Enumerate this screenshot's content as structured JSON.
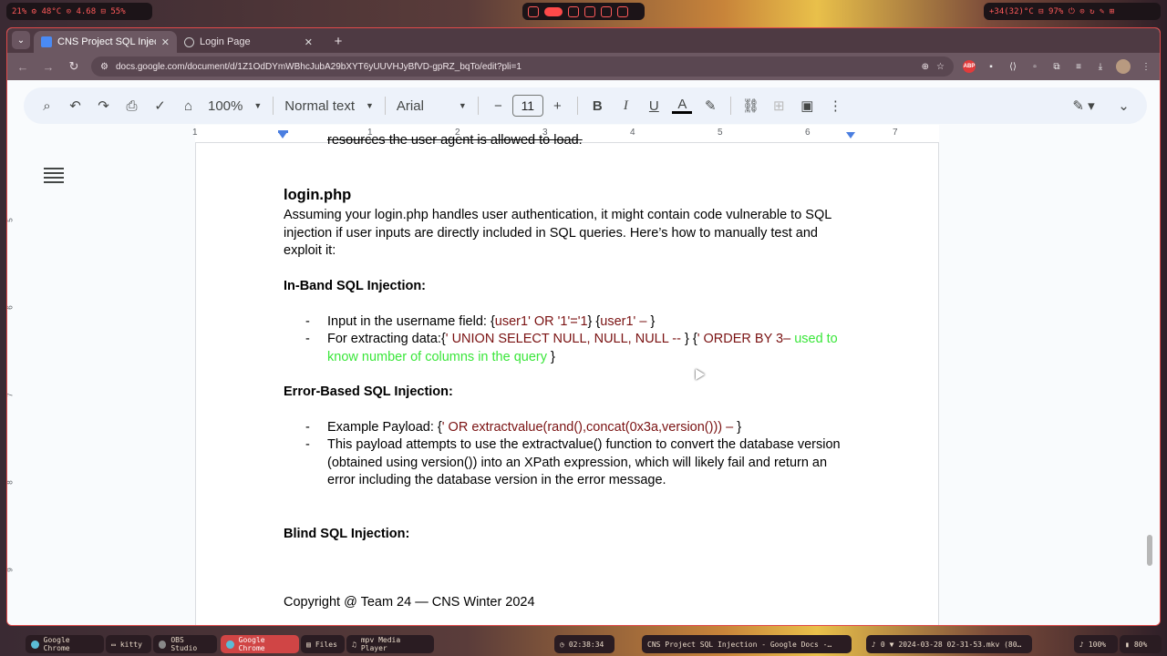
{
  "topbar": {
    "left_status": "21% ⚙ 48°C ⊙ 4.68 ⊟ 55%",
    "right_status": "+34(32)°C ⊟ 97% ⏻ ⊙ ↻ ✎ ⊞"
  },
  "browser": {
    "tabs": [
      {
        "label": "CNS Project SQL Injectio",
        "active": true
      },
      {
        "label": "Login Page",
        "active": false
      }
    ],
    "url": "docs.google.com/document/d/1Z1OdDYmWBhcJubA29bXYT6yUUVHJyBfVD-gpRZ_bqTo/edit?pli=1"
  },
  "toolbar": {
    "zoom": "100%",
    "style": "Normal text",
    "font": "Arial",
    "font_size": "11",
    "bold": "B",
    "italic": "I",
    "underline": "U",
    "text_color": "A"
  },
  "ruler": {
    "numbers": [
      "1",
      "1",
      "2",
      "3",
      "4",
      "5",
      "6",
      "7"
    ]
  },
  "document": {
    "prev_line": "resources the user agent is allowed to load.",
    "heading": "login.php",
    "intro": "Assuming your login.php handles user authentication, it might contain code vulnerable to SQL injection if user inputs are directly included in SQL queries. Here’s how to manually test and exploit it:",
    "section1": "In-Band SQL Injection:",
    "s1_item1_prefix": "Input in the username field: {",
    "s1_item1_code1": "user1' OR '1'='1",
    "s1_item1_mid": "}    {",
    "s1_item1_code2": "user1' – ",
    "s1_item1_suffix": "}",
    "s1_item2_prefix": "For extracting data:{",
    "s1_item2_code1": "' UNION SELECT NULL, NULL, NULL -- ",
    "s1_item2_mid": "} {",
    "s1_item2_code2": "' ORDER BY 3– ",
    "s1_item2_note": "used to know number of columns in the query",
    "s1_item2_suffix": " }",
    "section2": "Error-Based SQL Injection:",
    "s2_item1_prefix": "Example Payload: {",
    "s2_item1_code": "' OR extractvalue(rand(),concat(0x3a,version())) – ",
    "s2_item1_suffix": "}",
    "s2_item2": "This payload attempts to use the extractvalue() function to convert the database version (obtained using version()) into an XPath expression, which will likely fail and return an error including the database version in the error message.",
    "section3": "Blind SQL Injection:",
    "footer": "Copyright @ Team 24 — CNS Winter 2024"
  },
  "taskbar": {
    "items": [
      "Google Chrome",
      "kitty",
      "OBS Studio",
      "Google Chrome",
      "Files",
      "mpv Media Player"
    ],
    "clock": "02:38:34",
    "window_title": "CNS Project SQL Injection - Google Docs -…",
    "recording": "2024-03-28 02-31-53.mkv (80…",
    "volume": "100%",
    "battery": "80%",
    "notifications": "0"
  }
}
